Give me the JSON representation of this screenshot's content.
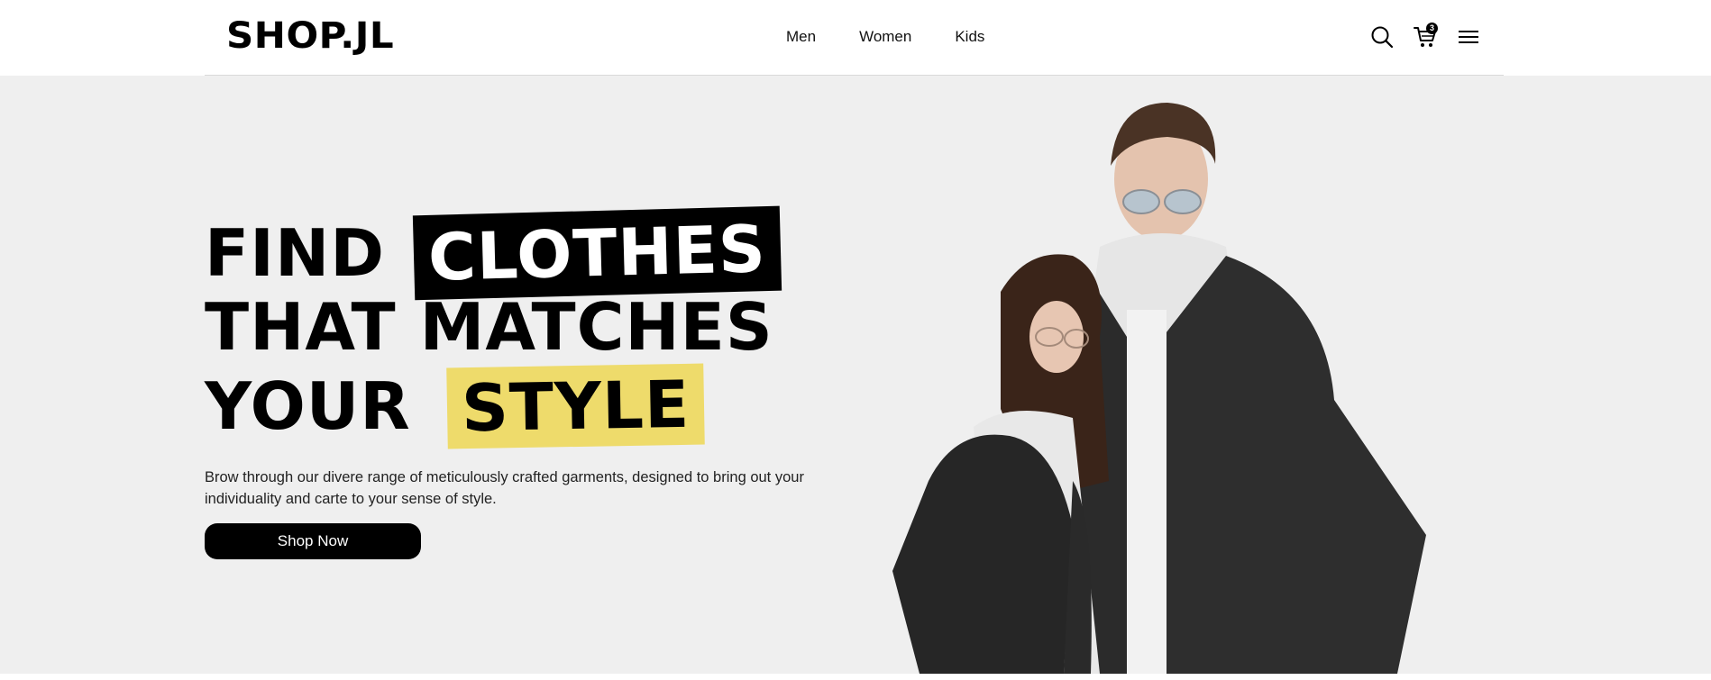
{
  "brand": {
    "logo": "SHOP.JL"
  },
  "nav": {
    "items": [
      "Men",
      "Women",
      "Kids"
    ]
  },
  "header_icons": {
    "search": "search-icon",
    "cart": "cart-icon",
    "cart_count": "3",
    "menu": "hamburger-menu-icon"
  },
  "hero": {
    "headline": {
      "line1_plain": "FIND",
      "line1_highlight": "CLOTHES",
      "line2": "THAT MATCHES",
      "line3_plain": "YOUR",
      "line3_highlight": "STYLE"
    },
    "description": "Brow through our divere range of meticulously crafted garments, designed to bring out your individuality and carte to your sense of style.",
    "cta_label": "Shop Now",
    "image": "couple-in-denim-jackets-photo"
  },
  "colors": {
    "hero_bg": "#efefef",
    "highlight_dark": "#000000",
    "highlight_yellow": "#eedb6b",
    "button": "#000000"
  }
}
